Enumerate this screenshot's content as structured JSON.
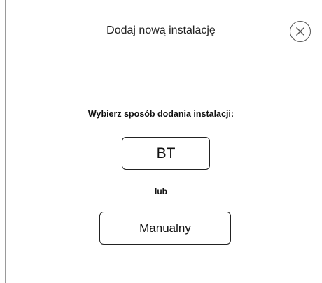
{
  "dialog": {
    "title": "Dodaj nową instalację",
    "close_icon": "close-circle-icon",
    "prompt": "Wybierz sposób dodania instalacji:",
    "options": {
      "bt_label": "BT",
      "separator": "lub",
      "manual_label": "Manualny"
    }
  },
  "colors": {
    "background": "#ffffff",
    "text": "#111111",
    "border": "#222222"
  }
}
